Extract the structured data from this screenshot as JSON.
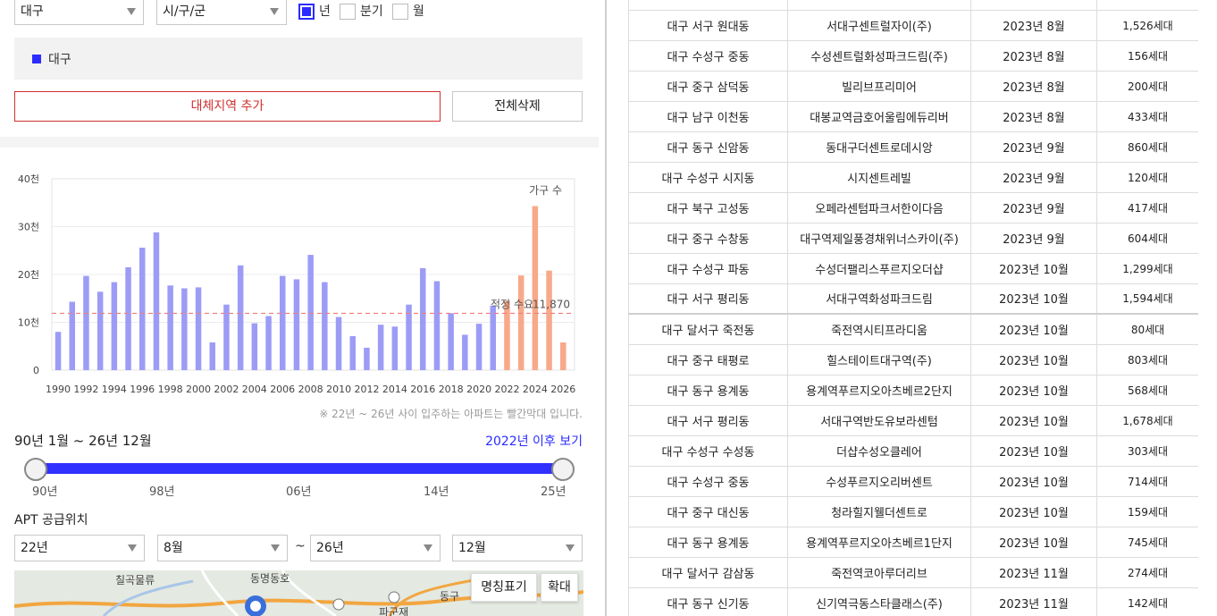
{
  "filters": {
    "region_select": "대구",
    "district_select": "시/구/군",
    "period_options": [
      {
        "label": "년",
        "checked": true
      },
      {
        "label": "분기",
        "checked": false
      },
      {
        "label": "월",
        "checked": false
      }
    ]
  },
  "selected_regions": [
    "대구"
  ],
  "buttons": {
    "add_region": "대체지역 추가",
    "delete_all": "전체삭제"
  },
  "chart_data": {
    "type": "bar",
    "title": "",
    "legend_label": "가구 수",
    "y_ticks": [
      "40천",
      "30천",
      "20천",
      "10천",
      "0"
    ],
    "ylim": [
      0,
      40000
    ],
    "x_tick_labels": [
      "1990",
      "1992",
      "1994",
      "1996",
      "1998",
      "2000",
      "2002",
      "2004",
      "2006",
      "2008",
      "2010",
      "2012",
      "2014",
      "2016",
      "2018",
      "2020",
      "2022",
      "2024",
      "2026"
    ],
    "categories": [
      "1990",
      "1991",
      "1992",
      "1993",
      "1994",
      "1995",
      "1996",
      "1997",
      "1998",
      "1999",
      "2000",
      "2001",
      "2002",
      "2003",
      "2004",
      "2005",
      "2006",
      "2007",
      "2008",
      "2009",
      "2010",
      "2011",
      "2012",
      "2013",
      "2014",
      "2015",
      "2016",
      "2017",
      "2018",
      "2019",
      "2020",
      "2021",
      "2022",
      "2023",
      "2024",
      "2025",
      "2026"
    ],
    "values": [
      8000,
      14300,
      19700,
      16400,
      18400,
      21500,
      25600,
      28800,
      17700,
      17100,
      17300,
      5800,
      13700,
      21900,
      9800,
      11300,
      19700,
      19000,
      24100,
      18400,
      11100,
      7100,
      4700,
      9500,
      9100,
      13700,
      21300,
      18600,
      11900,
      7400,
      9700,
      13500,
      14500,
      19800,
      34300,
      20800,
      5800,
      2600
    ],
    "highlight_from": "2022",
    "colors": {
      "past": "#9c9cf7",
      "future": "#f7a98a",
      "reference": "#f08080"
    },
    "reference_line": {
      "label": "적정 수요",
      "value_label": "11,870",
      "value": 11870
    }
  },
  "chart_note": "※ 22년 ~ 26년 사이 입주하는 아파트는 빨간막대 입니다.",
  "range": {
    "label": "90년 1월 ~ 26년 12월",
    "link": "2022년 이후 보기",
    "ticks": [
      "90년",
      "98년",
      "06년",
      "14년",
      "25년"
    ]
  },
  "apt": {
    "title": "APT 공급위치",
    "from_year": "22년",
    "from_month": "8월",
    "tilde": "~",
    "to_year": "26년",
    "to_month": "12월"
  },
  "map": {
    "name_toggle": "명칭표기",
    "zoom": "확대",
    "labels": [
      "칠곡물류",
      "동명동호",
      "파군재",
      "동구"
    ]
  },
  "supply_rows": [
    {
      "area": "대구 서구 원대동",
      "name": "서대구센트럴자이(주)",
      "date": "2023년 8월",
      "units": "1,526세대"
    },
    {
      "area": "대구 수성구 중동",
      "name": "수성센트럴화성파크드림(주)",
      "date": "2023년 8월",
      "units": "156세대"
    },
    {
      "area": "대구 중구 삼덕동",
      "name": "빌리브프리미어",
      "date": "2023년 8월",
      "units": "200세대"
    },
    {
      "area": "대구 남구 이천동",
      "name": "대봉교역금호어울림에듀리버",
      "date": "2023년 8월",
      "units": "433세대"
    },
    {
      "area": "대구 동구 신암동",
      "name": "동대구더센트로데시앙",
      "date": "2023년 9월",
      "units": "860세대"
    },
    {
      "area": "대구 수성구 시지동",
      "name": "시지센트레빌",
      "date": "2023년 9월",
      "units": "120세대"
    },
    {
      "area": "대구 북구 고성동",
      "name": "오페라센텀파크서한이다음",
      "date": "2023년 9월",
      "units": "417세대"
    },
    {
      "area": "대구 중구 수창동",
      "name": "대구역제일풍경채위너스카이(주)",
      "date": "2023년 9월",
      "units": "604세대"
    },
    {
      "area": "대구 수성구 파동",
      "name": "수성더팰리스푸르지오더샵",
      "date": "2023년 10월",
      "units": "1,299세대"
    },
    {
      "area": "대구 서구 평리동",
      "name": "서대구역화성파크드림",
      "date": "2023년 10월",
      "units": "1,594세대"
    },
    {
      "area": "대구 달서구 죽전동",
      "name": "죽전역시티프라디움",
      "date": "2023년 10월",
      "units": "80세대"
    },
    {
      "area": "대구 중구 태평로",
      "name": "힐스테이트대구역(주)",
      "date": "2023년 10월",
      "units": "803세대"
    },
    {
      "area": "대구 동구 용계동",
      "name": "용계역푸르지오아츠베르2단지",
      "date": "2023년 10월",
      "units": "568세대"
    },
    {
      "area": "대구 서구 평리동",
      "name": "서대구역반도유보라센텀",
      "date": "2023년 10월",
      "units": "1,678세대"
    },
    {
      "area": "대구 수성구 수성동",
      "name": "더샵수성오클레어",
      "date": "2023년 10월",
      "units": "303세대"
    },
    {
      "area": "대구 수성구 중동",
      "name": "수성푸르지오리버센트",
      "date": "2023년 10월",
      "units": "714세대"
    },
    {
      "area": "대구 중구 대신동",
      "name": "청라힐지웰더센트로",
      "date": "2023년 10월",
      "units": "159세대"
    },
    {
      "area": "대구 동구 용계동",
      "name": "용계역푸르지오아츠베르1단지",
      "date": "2023년 10월",
      "units": "745세대"
    },
    {
      "area": "대구 달서구 감삼동",
      "name": "죽전역코아루더리브",
      "date": "2023년 11월",
      "units": "274세대"
    },
    {
      "area": "대구 동구 신기동",
      "name": "신기역극동스타클래스(주)",
      "date": "2023년 11월",
      "units": "142세대"
    }
  ]
}
